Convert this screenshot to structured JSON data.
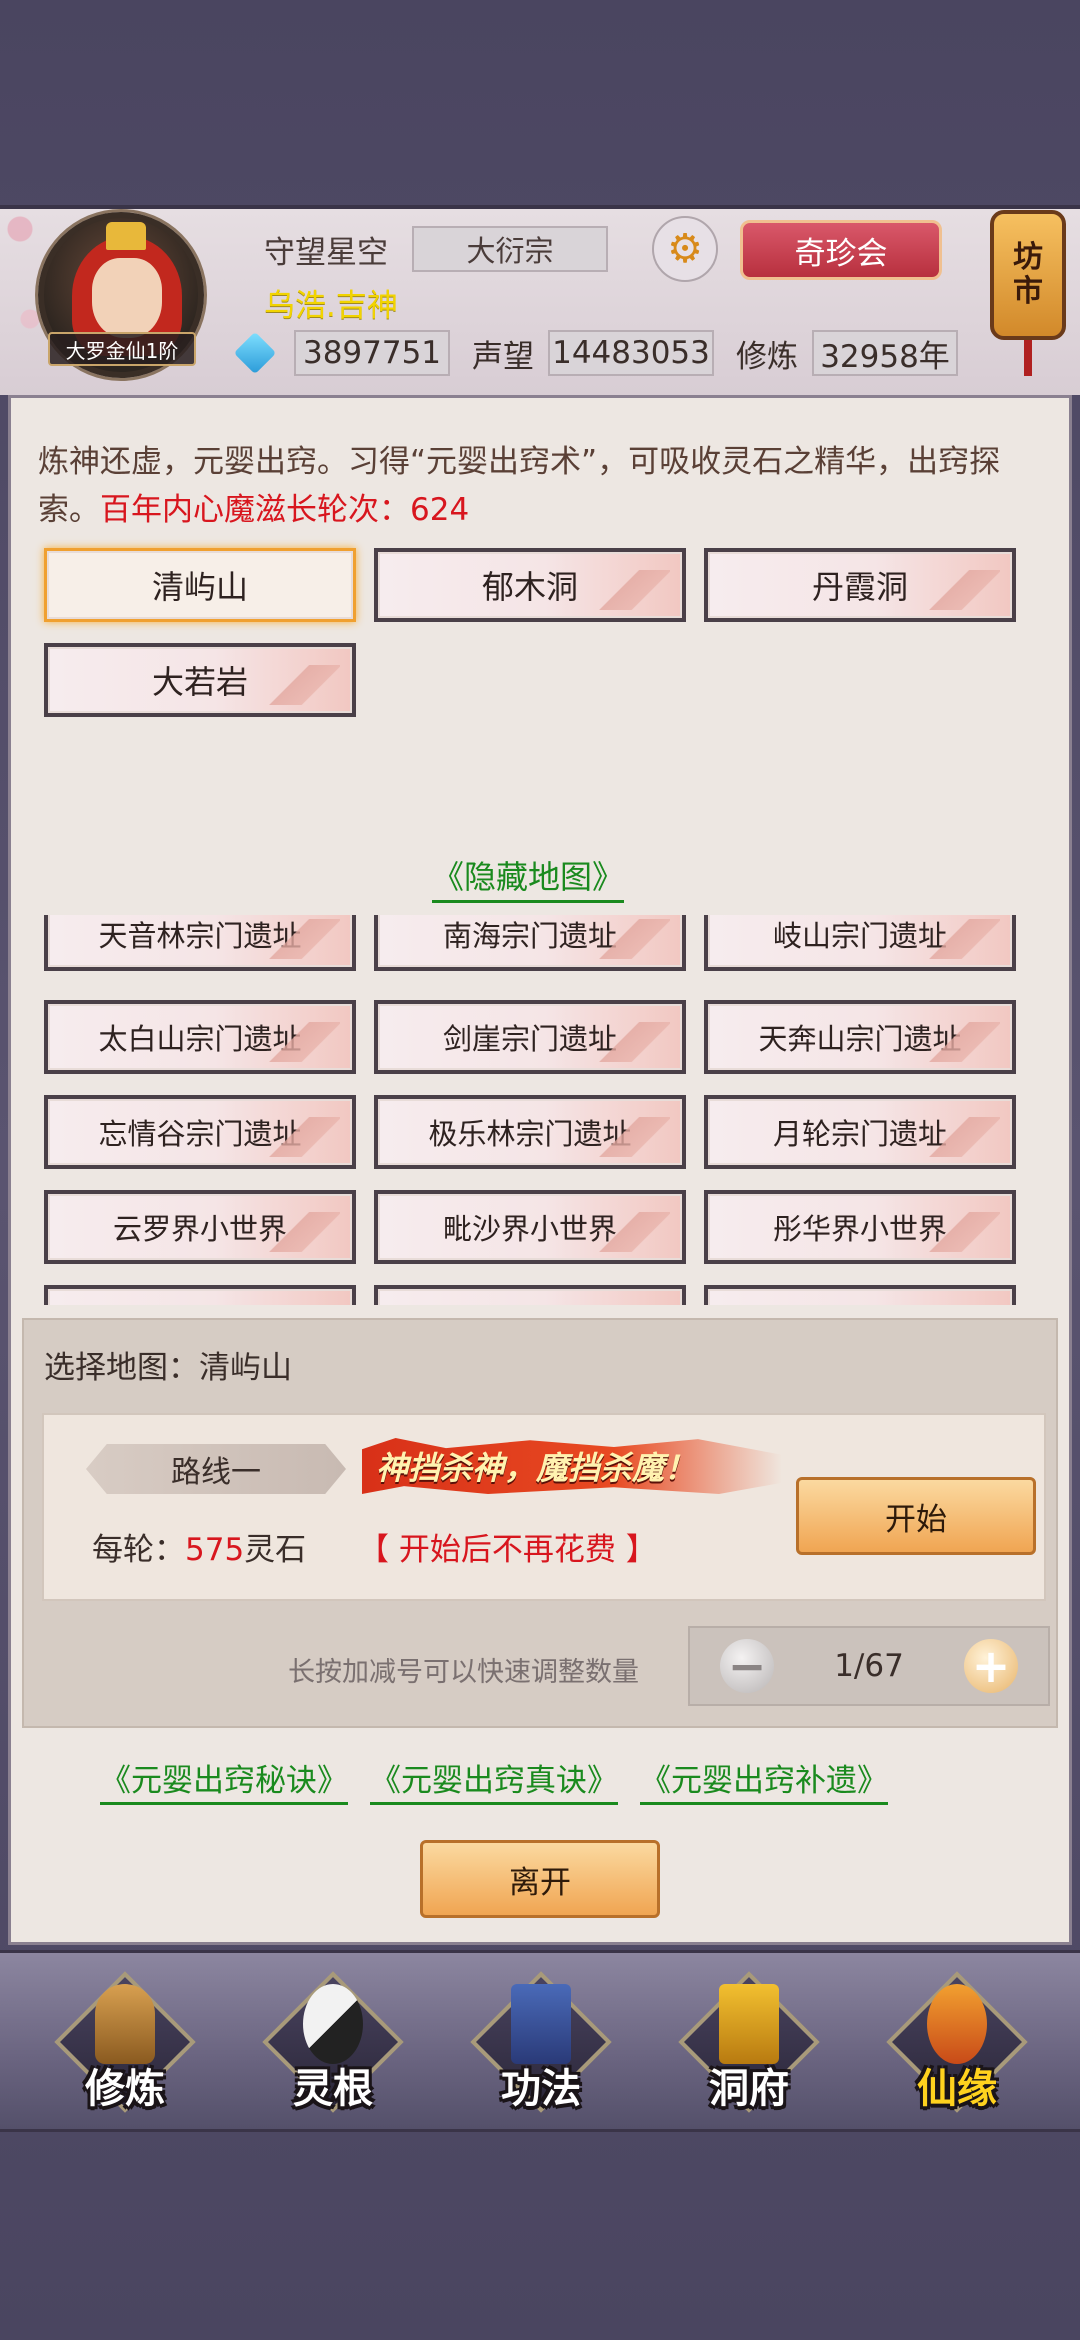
{
  "player": {
    "name": "守望星空",
    "sect": "大衍宗",
    "title": "乌浩.吉神",
    "rank": "大罗金仙1阶",
    "spirit_stones": "3897751",
    "reputation_label": "声望",
    "reputation": "14483053",
    "cultivation_label": "修炼",
    "cultivation": "32958年"
  },
  "header": {
    "treasure_button": "奇珍会",
    "market_line1": "坊",
    "market_line2": "市"
  },
  "intro": {
    "text": "炼神还虚，元婴出窍。习得“元婴出窍术”，可吸收灵石之精华，出窍探索。",
    "highlight": "百年内心魔滋长轮次：624"
  },
  "maps": [
    "清屿山",
    "郁木洞",
    "丹霞洞",
    "大若岩"
  ],
  "hidden_map_link": "《隐藏地图》",
  "hidden_maps": [
    "天音林宗门遗址",
    "南海宗门遗址",
    "岐山宗门遗址",
    "太白山宗门遗址",
    "剑崖宗门遗址",
    "天奔山宗门遗址",
    "忘情谷宗门遗址",
    "极乐林宗门遗址",
    "月轮宗门遗址",
    "云罗界小世界",
    "毗沙界小世界",
    "彤华界小世界"
  ],
  "selection": {
    "label": "选择地图：清屿山",
    "route_name": "路线一",
    "slogan": "神挡杀神，魔挡杀魔！",
    "cost_prefix": "每轮：",
    "cost_value": "575",
    "cost_suffix": "灵石",
    "free_note": "【 开始后不再花费 】",
    "start_button": "开始",
    "hint": "长按加减号可以快速调整数量",
    "stepper_value": "1/67"
  },
  "guides": [
    "《元婴出窍秘诀》",
    "《元婴出窍真诀》",
    "《元婴出窍补遗》"
  ],
  "leave_button": "离开",
  "nav": [
    "修炼",
    "灵根",
    "功法",
    "洞府",
    "仙缘"
  ]
}
